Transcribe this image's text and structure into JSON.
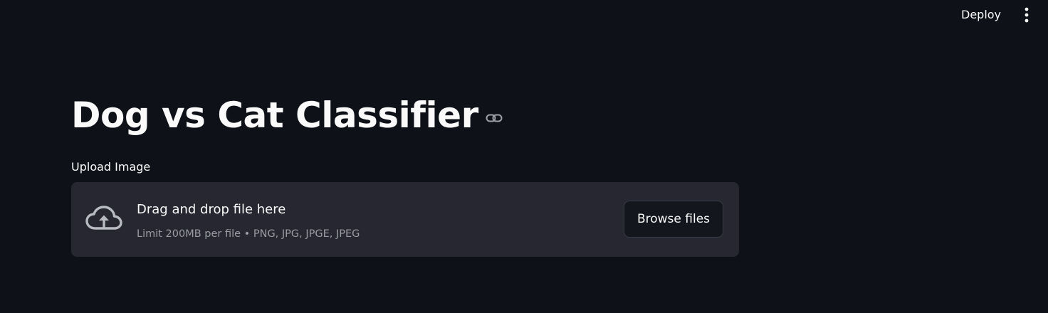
{
  "header": {
    "deploy_label": "Deploy",
    "menu_icon": "vertical-ellipsis-icon"
  },
  "main": {
    "title": "Dog vs Cat Classifier",
    "title_link_icon": "link-icon",
    "uploader": {
      "label": "Upload Image",
      "icon": "cloud-upload-icon",
      "instruction": "Drag and drop file here",
      "limit_text": "Limit 200MB per file • PNG, JPG, JPGE, JPEG",
      "browse_label": "Browse files"
    }
  },
  "colors": {
    "background": "#0e1117",
    "dropzone": "#262730",
    "text": "#fafafa",
    "muted_text": "#9a9ca3"
  }
}
